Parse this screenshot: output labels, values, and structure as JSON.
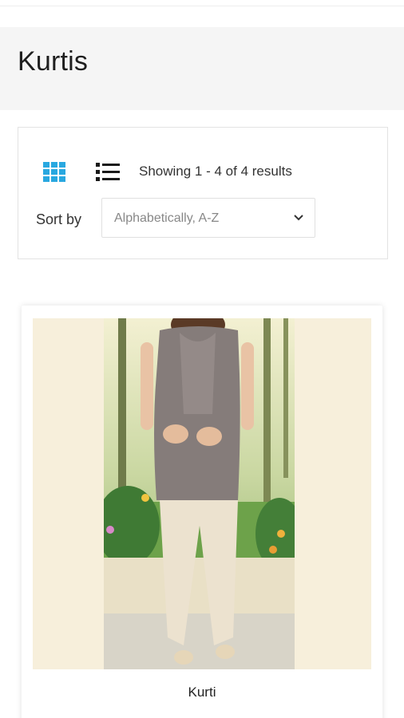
{
  "page": {
    "title": "Kurtis"
  },
  "toolbar": {
    "results_text": "Showing 1 - 4 of 4 results",
    "sort_label": "Sort by",
    "sort_value": "Alphabetically, A-Z",
    "grid_icon": "grid-view-icon",
    "list_icon": "list-view-icon",
    "active_view": "grid"
  },
  "colors": {
    "accent": "#29a8e0",
    "icon_dark": "#1a1a1a",
    "image_backdrop": "#f7efdb"
  },
  "products": [
    {
      "name": "Kurti"
    }
  ]
}
